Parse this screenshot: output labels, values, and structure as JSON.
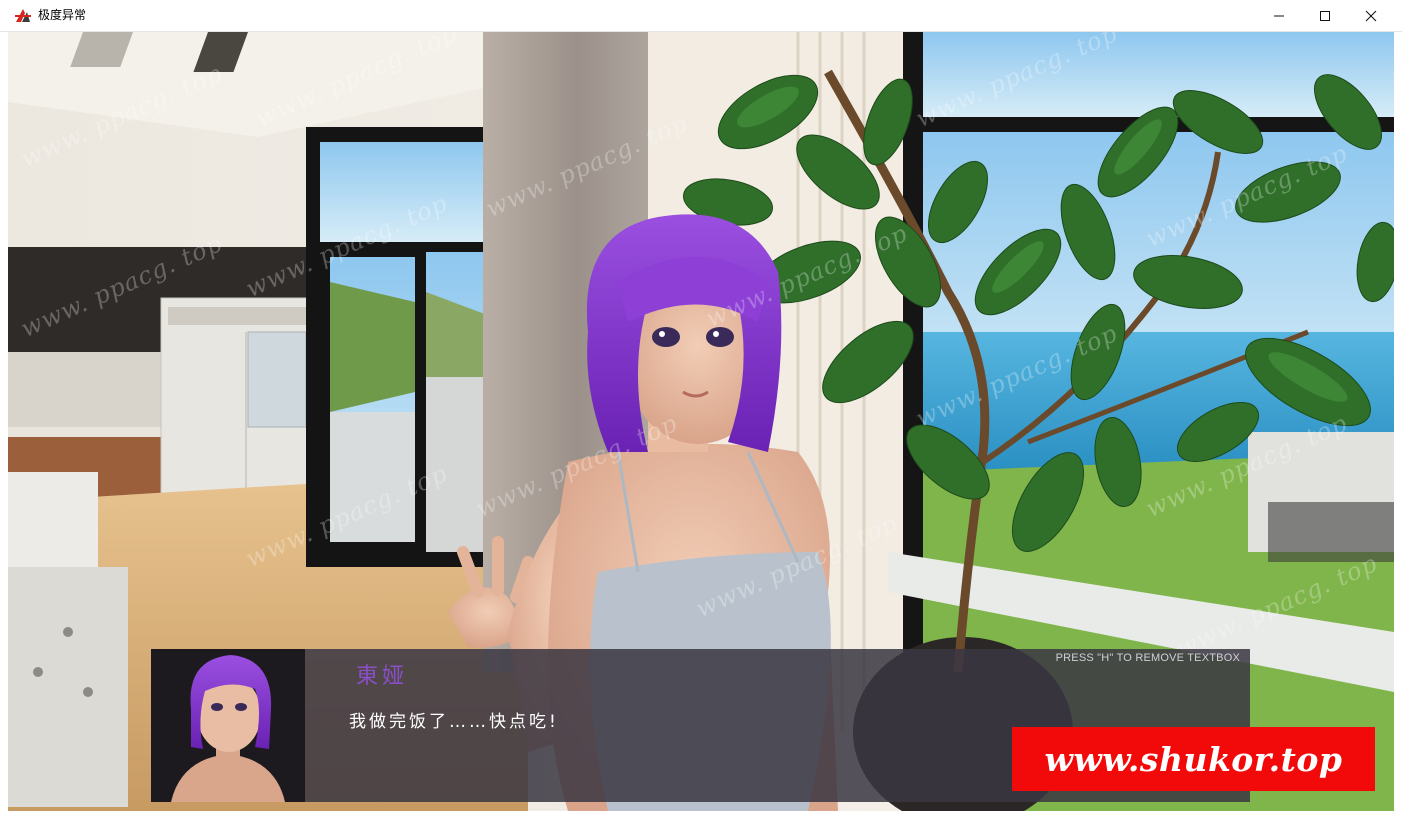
{
  "window": {
    "title": "极度异常",
    "icon": "app-logo-icon",
    "controls": [
      "minimize-icon",
      "maximize-icon",
      "close-icon"
    ]
  },
  "dialogue": {
    "speaker": "東娅",
    "line": "我做完饭了……快点吃!",
    "hint": "PRESS \"H\" TO REMOVE TEXTBOX"
  },
  "watermark": {
    "text": "www. ppacg. top"
  },
  "overlay": {
    "promo": "www.shukor.top"
  },
  "colors": {
    "speaker": "#8a4fc9",
    "hair": "#7a2fc0",
    "textbox": "#3a3742",
    "promo_bg": "#f20a0a"
  }
}
